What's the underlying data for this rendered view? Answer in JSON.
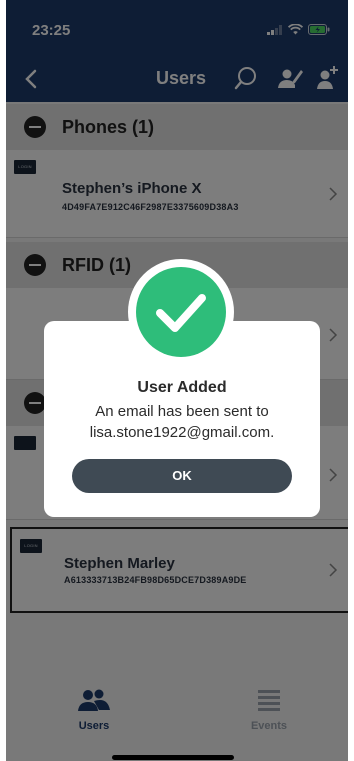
{
  "status": {
    "time": "23:25"
  },
  "nav": {
    "title": "Users"
  },
  "sections": [
    {
      "title": "Phones (1)"
    },
    {
      "title": "RFID (1)"
    }
  ],
  "rows": [
    {
      "badge": "LOGIN",
      "name": "Stephen’s iPhone X",
      "id": "4D49FA7E912C46F2987E3375609D38A3"
    },
    {
      "badge": "LOGIN",
      "name": "Stephen Marley",
      "id": "A613333713B24FB98D65DCE7D389A9DE"
    }
  ],
  "tabs": [
    {
      "label": "Users",
      "icon": "users-icon"
    },
    {
      "label": "Events",
      "icon": "events-icon"
    }
  ],
  "dialog": {
    "title": "User Added",
    "message_line1": "An email has been sent to",
    "message_line2": "lisa.stone1922@gmail.com.",
    "ok_label": "OK"
  },
  "colors": {
    "nav": "#1c3a6b",
    "success": "#2ebd7a",
    "button": "#3f4a54"
  }
}
